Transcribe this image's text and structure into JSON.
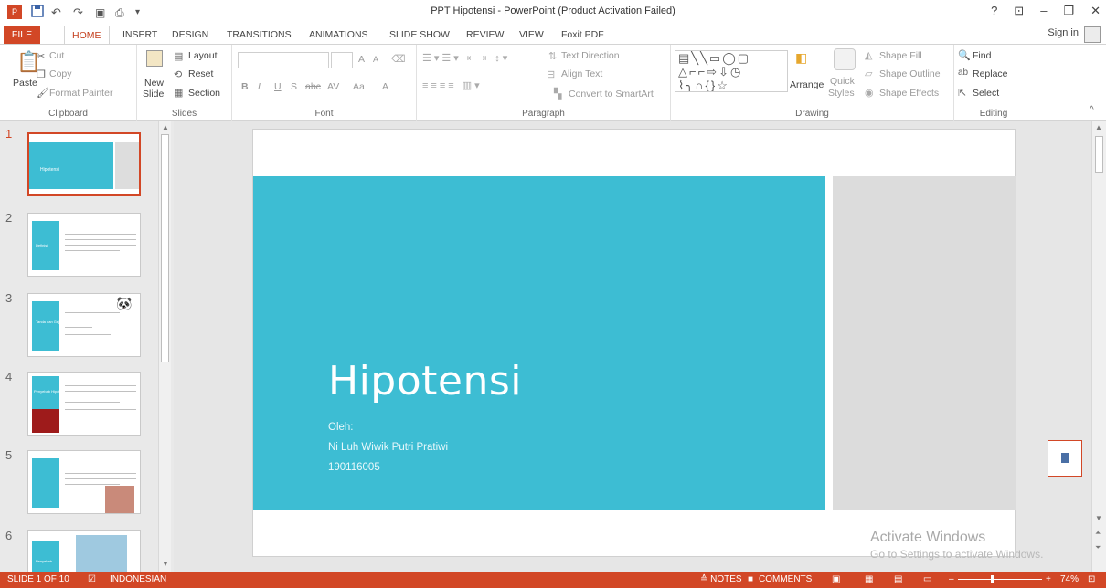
{
  "window": {
    "title": "PPT Hipotensi - PowerPoint (Product Activation Failed)",
    "help": "?",
    "minimize": "–",
    "restore": "❐",
    "close": "✕"
  },
  "quick_access": {
    "save_icon": "save-icon",
    "undo": "↶",
    "redo": "↷"
  },
  "tabs": [
    "FILE",
    "HOME",
    "INSERT",
    "DESIGN",
    "TRANSITIONS",
    "ANIMATIONS",
    "SLIDE SHOW",
    "REVIEW",
    "VIEW",
    "Foxit PDF"
  ],
  "sign_in": "Sign in",
  "ribbon": {
    "clipboard": {
      "label": "Clipboard",
      "paste": "Paste",
      "cut": "Cut",
      "copy": "Copy",
      "format_painter": "Format Painter"
    },
    "slides": {
      "label": "Slides",
      "new_slide": "New",
      "new_slide2": "Slide",
      "layout": "Layout",
      "reset": "Reset",
      "section": "Section"
    },
    "font": {
      "label": "Font",
      "grow": "A",
      "shrink": "A",
      "bold": "B",
      "italic": "I",
      "underline": "U",
      "strike": "S",
      "abc": "abc",
      "spacing": "AV",
      "case": "Aa",
      "color": "A"
    },
    "paragraph": {
      "label": "Paragraph",
      "text_direction": "Text Direction",
      "align_text": "Align Text",
      "convert_smartart": "Convert to SmartArt"
    },
    "drawing": {
      "label": "Drawing",
      "arrange": "Arrange",
      "quick_styles": "Quick",
      "quick_styles2": "Styles",
      "shape_fill": "Shape Fill",
      "shape_outline": "Shape Outline",
      "shape_effects": "Shape Effects"
    },
    "editing": {
      "label": "Editing",
      "find": "Find",
      "replace": "Replace",
      "select": "Select"
    }
  },
  "thumbnails": [
    {
      "number": "1",
      "title": "Hipotensi"
    },
    {
      "number": "2",
      "title": "Definisi"
    },
    {
      "number": "3",
      "title": "Tanda dan Gejala"
    },
    {
      "number": "4",
      "title": "Penyebab Hipotensi"
    },
    {
      "number": "5",
      "title": ""
    },
    {
      "number": "6",
      "title": "Penyebab"
    }
  ],
  "slide": {
    "title": "Hipotensi",
    "subtitle_lines": [
      "Oleh:",
      "Ni Luh Wiwik Putri Pratiwi",
      "190116005"
    ]
  },
  "watermark": {
    "line1": "Activate Windows",
    "line2": "Go to Settings to activate Windows."
  },
  "status": {
    "slide_info": "SLIDE 1 OF 10",
    "language": "INDONESIAN",
    "notes": "≙ NOTES",
    "comments": "COMMENTS",
    "zoom": "74%"
  }
}
